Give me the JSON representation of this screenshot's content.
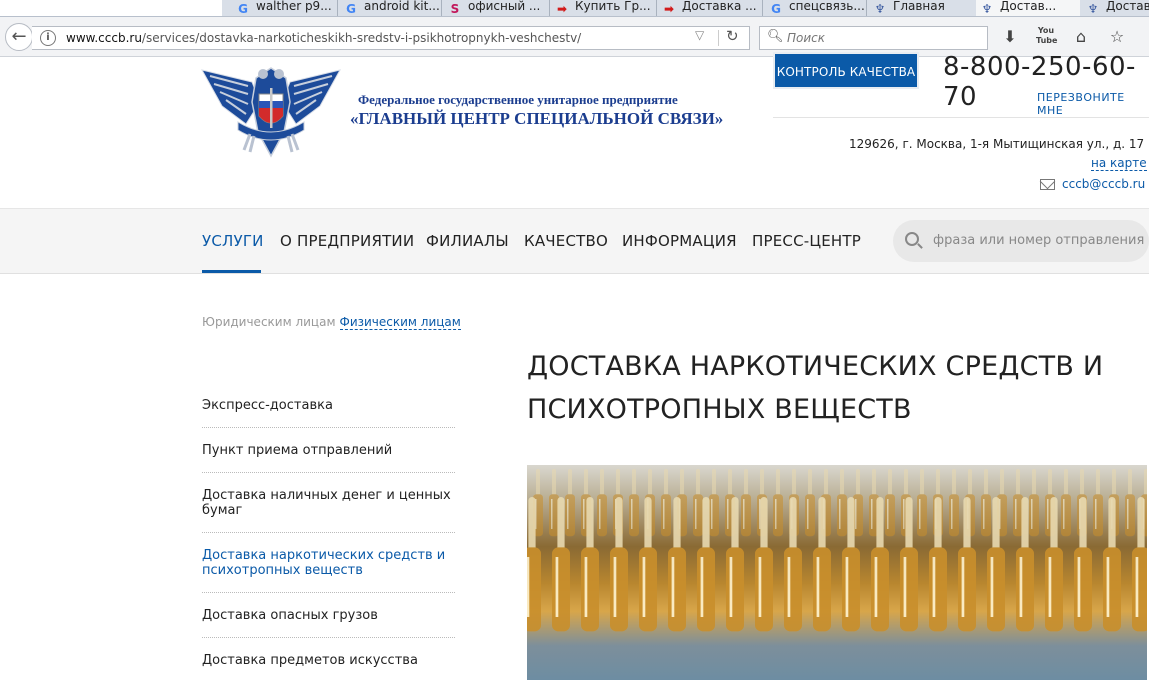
{
  "browser": {
    "tabs": [
      {
        "label": "",
        "icon": "generic-page-icon",
        "active": false
      },
      {
        "label": "walther p9...",
        "icon": "google-icon",
        "active": false
      },
      {
        "label": "android kit...",
        "icon": "google-icon",
        "active": false
      },
      {
        "label": "офисный ...",
        "icon": "s-icon",
        "active": false
      },
      {
        "label": "Купить Гр...",
        "icon": "arrow-icon",
        "active": false
      },
      {
        "label": "Доставка ...",
        "icon": "arrow-icon",
        "active": false
      },
      {
        "label": "спецсвязь...",
        "icon": "google-icon",
        "active": false
      },
      {
        "label": "Главная",
        "icon": "eagle-icon",
        "active": false
      },
      {
        "label": "Достав...",
        "icon": "eagle-icon",
        "active": true
      },
      {
        "label": "Достав",
        "icon": "eagle-icon",
        "active": false
      }
    ],
    "url_domain": "www.cccb.ru",
    "url_path": "/services/dostavka-narkoticheskikh-sredstv-i-psikhotropnykh-veshchestv/",
    "search_placeholder": "Поиск",
    "youtube_label": "You Tube"
  },
  "header": {
    "org_line1": "Федеральное государственное унитарное предприятие",
    "org_line2": "«ГЛАВНЫЙ ЦЕНТР СПЕЦИАЛЬНОЙ СВЯЗИ»",
    "quality_button": "КОНТРОЛЬ КАЧЕСТВА",
    "phone": "8-800-250-60-70",
    "callback": "ПЕРЕЗВОНИТЕ МНЕ",
    "address": "129626, г. Москва, 1-я Мытищинская ул., д. 17",
    "map_link": "на карте",
    "email": "cccb@cccb.ru",
    "brand_color": "#0b5aa8"
  },
  "nav": {
    "items": [
      "УСЛУГИ",
      "О ПРЕДПРИЯТИИ",
      "ФИЛИАЛЫ",
      "КАЧЕСТВО",
      "ИНФОРМАЦИЯ",
      "ПРЕСС-ЦЕНТР"
    ],
    "active_index": 0,
    "search_placeholder": "фраза или номер отправления"
  },
  "segment": {
    "legal": "Юридическим лицам",
    "individual": "Физическим лицам"
  },
  "sidemenu": {
    "items": [
      "Экспресс-доставка",
      "Пункт приема отправлений",
      "Доставка наличных денег и ценных бумаг",
      "Доставка наркотических средств и психотропных веществ",
      "Доставка опасных грузов",
      "Доставка предметов искусства"
    ],
    "active_index": 3
  },
  "content": {
    "title": "ДОСТАВКА НАРКОТИЧЕСКИХ СРЕДСТВ И ПСИХОТРОПНЫХ ВЕЩЕСТВ",
    "image": "glass-ampoules-photo"
  }
}
